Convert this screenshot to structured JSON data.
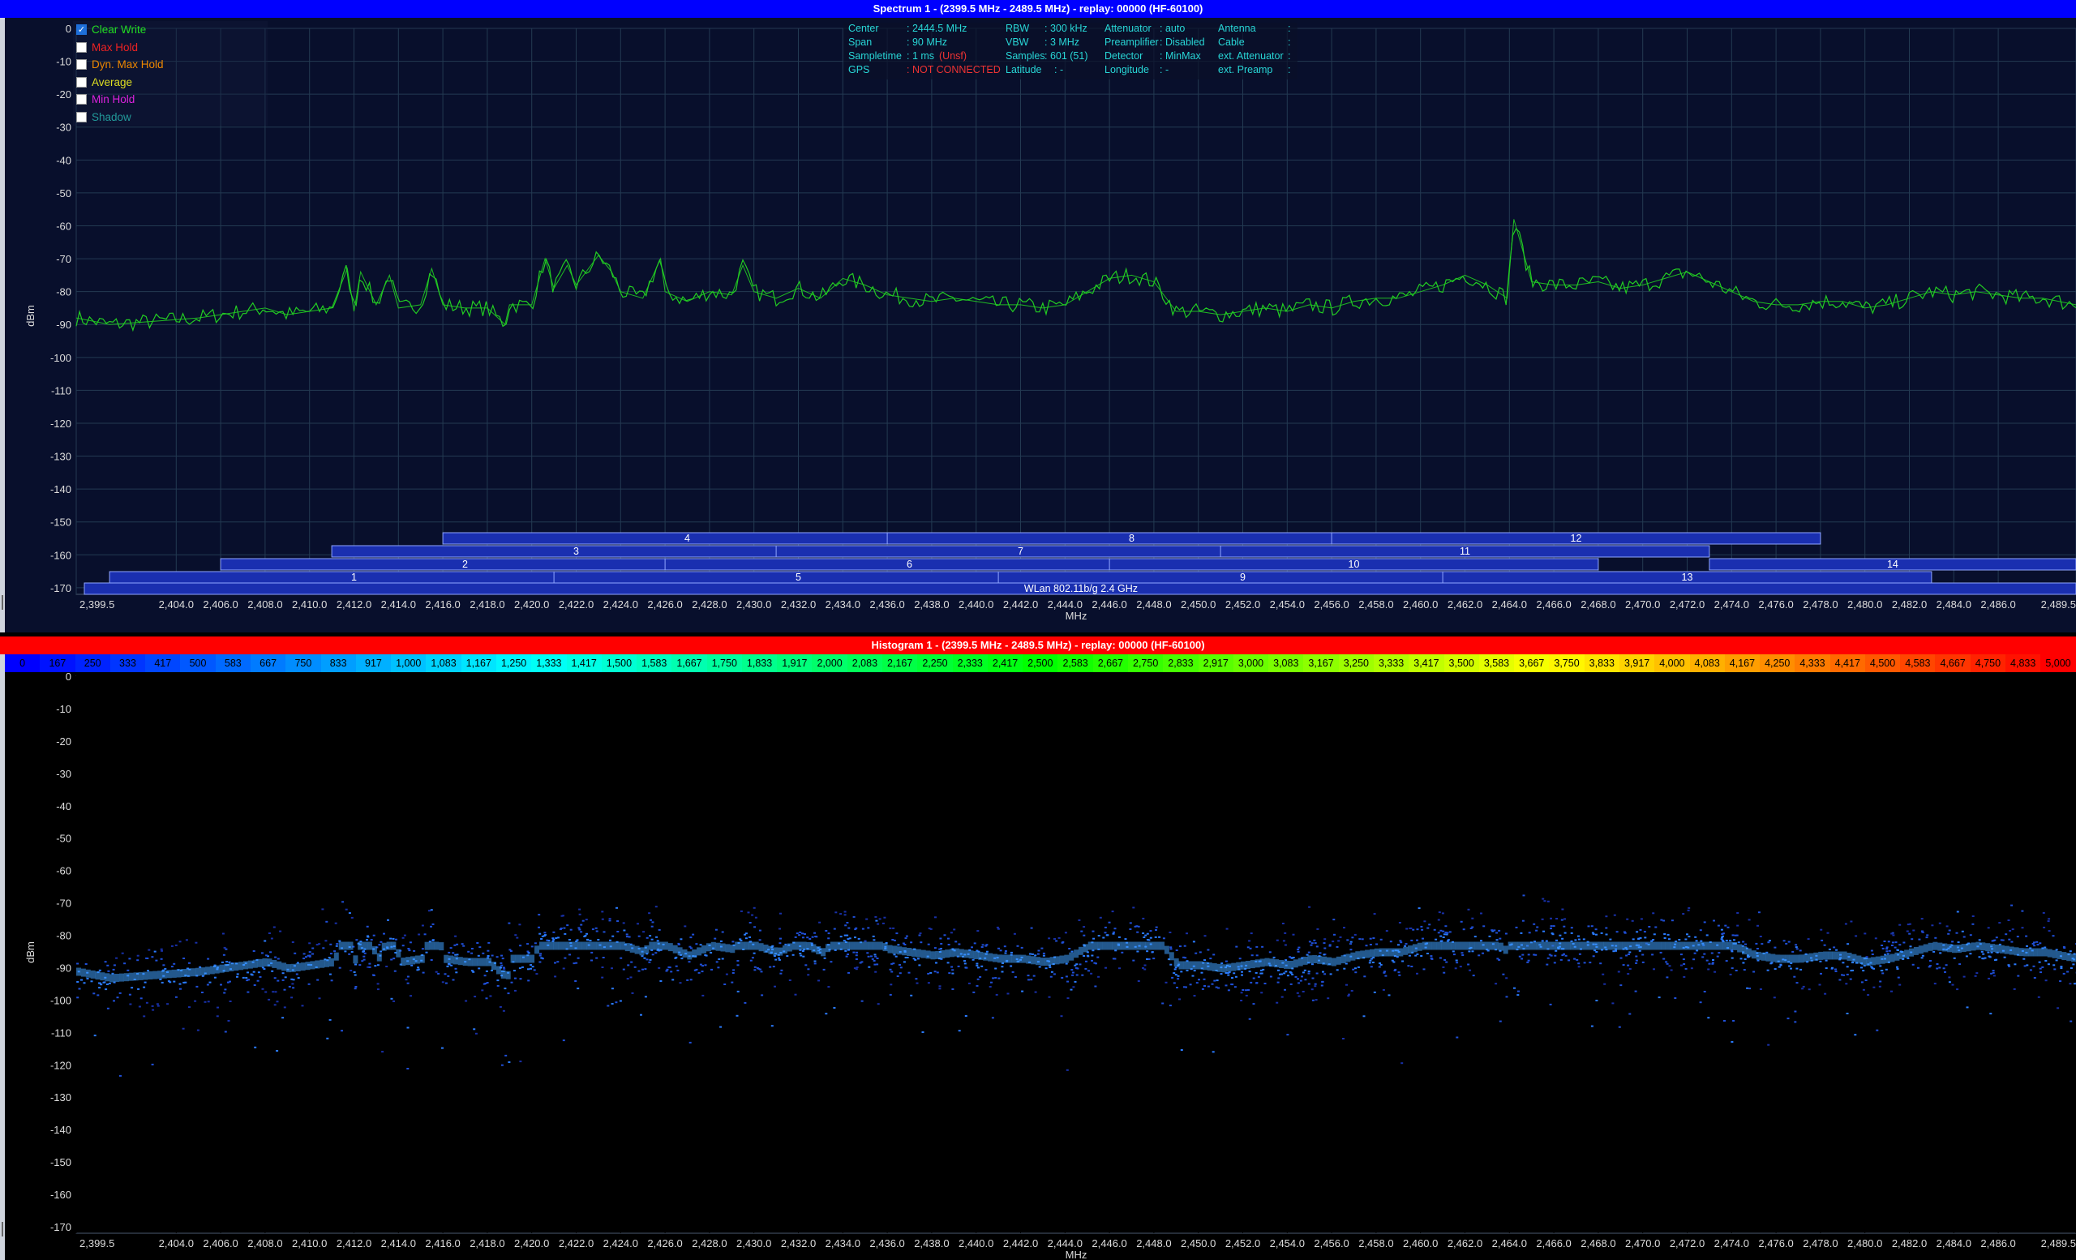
{
  "spectrum": {
    "title": "Spectrum 1 -  (2399.5 MHz - 2489.5 MHz) - replay: 00000 (HF-60100)",
    "ylabel": "dBm",
    "xlabel": "MHz",
    "y_ticks": [
      "0",
      "-10",
      "-20",
      "-30",
      "-40",
      "-50",
      "-60",
      "-70",
      "-80",
      "-90",
      "-100",
      "-110",
      "-120",
      "-130",
      "-140",
      "-150",
      "-160",
      "-170"
    ],
    "x_ticks": [
      "2,399.5",
      "2,404.0",
      "2,406.0",
      "2,408.0",
      "2,410.0",
      "2,412.0",
      "2,414.0",
      "2,416.0",
      "2,418.0",
      "2,420.0",
      "2,422.0",
      "2,424.0",
      "2,426.0",
      "2,428.0",
      "2,430.0",
      "2,432.0",
      "2,434.0",
      "2,436.0",
      "2,438.0",
      "2,440.0",
      "2,442.0",
      "2,444.0",
      "2,446.0",
      "2,448.0",
      "2,450.0",
      "2,452.0",
      "2,454.0",
      "2,456.0",
      "2,458.0",
      "2,460.0",
      "2,462.0",
      "2,464.0",
      "2,466.0",
      "2,468.0",
      "2,470.0",
      "2,472.0",
      "2,474.0",
      "2,476.0",
      "2,478.0",
      "2,480.0",
      "2,482.0",
      "2,484.0",
      "2,486.0",
      "2,489.5"
    ],
    "legend": [
      {
        "label": "Clear Write",
        "color": "#22dd22",
        "checked": true
      },
      {
        "label": "Max Hold",
        "color": "#ee2222",
        "checked": false
      },
      {
        "label": "Dyn. Max Hold",
        "color": "#ee8800",
        "checked": false
      },
      {
        "label": "Average",
        "color": "#dddd22",
        "checked": false
      },
      {
        "label": "Min Hold",
        "color": "#dd22dd",
        "checked": false
      },
      {
        "label": "Shadow",
        "color": "#229999",
        "checked": false
      }
    ],
    "info": {
      "center_label": "Center",
      "center_value": ": 2444.5 MHz",
      "span_label": "Span",
      "span_value": ": 90 MHz",
      "sampletime_label": "Sampletime",
      "sampletime_value": ": 1 ms",
      "sampletime_note": "(Unsf)",
      "gps_label": "GPS",
      "gps_value": ": NOT CONNECTED",
      "rbw_label": "RBW",
      "rbw_value": ": 300 kHz",
      "vbw_label": "VBW",
      "vbw_value": ": 3 MHz",
      "samples_label": "Samples",
      "samples_value": ": 601 (51)",
      "latitude_label": "Latitude",
      "latitude_value": ": -",
      "attenuator_label": "Attenuator",
      "attenuator_value": ": auto",
      "preamp_label": "Preamplifier",
      "preamp_value": ": Disabled",
      "detector_label": "Detector",
      "detector_value": ": MinMax",
      "longitude_label": "Longitude",
      "longitude_value": ": -",
      "antenna_label": "Antenna",
      "antenna_value": ":",
      "cable_label": "Cable",
      "cable_value": ":",
      "ext_att_label": "ext. Attenuator",
      "ext_att_value": ":",
      "ext_preamp_label": "ext. Preamp",
      "ext_preamp_value": ":"
    },
    "wlan_label": "WLan 802.11b/g 2.4 GHz",
    "channels": [
      {
        "n": "1",
        "start": 2401,
        "end": 2423
      },
      {
        "n": "2",
        "start": 2406,
        "end": 2428
      },
      {
        "n": "3",
        "start": 2411,
        "end": 2433
      },
      {
        "n": "4",
        "start": 2416,
        "end": 2438
      },
      {
        "n": "5",
        "start": 2421,
        "end": 2443
      },
      {
        "n": "6",
        "start": 2426,
        "end": 2448
      },
      {
        "n": "7",
        "start": 2431,
        "end": 2453
      },
      {
        "n": "8",
        "start": 2436,
        "end": 2458
      },
      {
        "n": "9",
        "start": 2441,
        "end": 2463
      },
      {
        "n": "10",
        "start": 2446,
        "end": 2468
      },
      {
        "n": "11",
        "start": 2451,
        "end": 2473
      },
      {
        "n": "12",
        "start": 2456,
        "end": 2478
      },
      {
        "n": "13",
        "start": 2461,
        "end": 2483
      },
      {
        "n": "14",
        "start": 2473,
        "end": 2495
      }
    ],
    "colors": {
      "trace": "#22cc22",
      "grid": "#233a52",
      "channel_fill": "#1a2fb0",
      "channel_border": "#8fa6ff"
    }
  },
  "histogram": {
    "title": "Histogram 1 -  (2399.5 MHz - 2489.5 MHz) - replay: 00000 (HF-60100)",
    "scale": [
      "0",
      "167",
      "250",
      "333",
      "417",
      "500",
      "583",
      "667",
      "750",
      "833",
      "917",
      "1,000",
      "1,083",
      "1,167",
      "1,250",
      "1,333",
      "1,417",
      "1,500",
      "1,583",
      "1,667",
      "1,750",
      "1,833",
      "1,917",
      "2,000",
      "2,083",
      "2,167",
      "2,250",
      "2,333",
      "2,417",
      "2,500",
      "2,583",
      "2,667",
      "2,750",
      "2,833",
      "2,917",
      "3,000",
      "3,083",
      "3,167",
      "3,250",
      "3,333",
      "3,417",
      "3,500",
      "3,583",
      "3,667",
      "3,750",
      "3,833",
      "3,917",
      "4,000",
      "4,083",
      "4,167",
      "4,250",
      "4,333",
      "4,417",
      "4,500",
      "4,583",
      "4,667",
      "4,750",
      "4,833",
      "5,000"
    ],
    "ylabel": "dBm",
    "xlabel": "MHz"
  },
  "chart_data": [
    {
      "type": "line",
      "title": "Spectrum 1 -  (2399.5 MHz - 2489.5 MHz) - replay: 00000 (HF-60100)",
      "xlabel": "MHz",
      "ylabel": "dBm",
      "xlim": [
        2399.5,
        2489.5
      ],
      "ylim": [
        -172,
        0
      ],
      "series": [
        {
          "name": "Clear Write",
          "x": [
            2399.5,
            2401,
            2403,
            2405,
            2406,
            2407,
            2408,
            2409,
            2410,
            2411,
            2411.7,
            2412,
            2412.3,
            2413,
            2413.6,
            2414,
            2415,
            2415.5,
            2416,
            2417,
            2418,
            2418.8,
            2419,
            2420,
            2420.6,
            2421,
            2421.6,
            2422,
            2423,
            2423.6,
            2424,
            2425,
            2425.8,
            2426,
            2427,
            2428,
            2429,
            2429.5,
            2430,
            2431,
            2432,
            2433,
            2434,
            2435,
            2436,
            2437,
            2438,
            2439,
            2440,
            2441,
            2442,
            2443,
            2444,
            2445,
            2446,
            2447,
            2448,
            2449,
            2450,
            2451,
            2452,
            2453,
            2454,
            2455,
            2456,
            2457,
            2458,
            2459,
            2460,
            2461,
            2462,
            2463,
            2463.9,
            2464.2,
            2465,
            2466,
            2467,
            2468,
            2469,
            2470,
            2471,
            2472,
            2473,
            2474,
            2475,
            2476,
            2477,
            2478,
            2479,
            2480,
            2481,
            2482,
            2483,
            2484,
            2485,
            2486,
            2487,
            2488,
            2489.5
          ],
          "y": [
            -88,
            -90,
            -89,
            -88,
            -87,
            -86,
            -85,
            -87,
            -86,
            -85,
            -73,
            -86,
            -74,
            -84,
            -75,
            -85,
            -84,
            -73,
            -84,
            -85,
            -85,
            -90,
            -84,
            -84,
            -70,
            -79,
            -72,
            -78,
            -69,
            -74,
            -80,
            -82,
            -70,
            -80,
            -83,
            -80,
            -81,
            -72,
            -80,
            -82,
            -79,
            -82,
            -76,
            -78,
            -81,
            -82,
            -83,
            -82,
            -83,
            -84,
            -84,
            -85,
            -84,
            -80,
            -76,
            -75,
            -77,
            -86,
            -86,
            -87,
            -86,
            -85,
            -86,
            -84,
            -85,
            -83,
            -82,
            -82,
            -80,
            -78,
            -75,
            -78,
            -82,
            -58,
            -77,
            -78,
            -78,
            -77,
            -79,
            -78,
            -76,
            -74,
            -77,
            -80,
            -83,
            -84,
            -84,
            -83,
            -83,
            -85,
            -84,
            -82,
            -80,
            -81,
            -80,
            -81,
            -82,
            -82,
            -84
          ]
        }
      ]
    }
  ]
}
